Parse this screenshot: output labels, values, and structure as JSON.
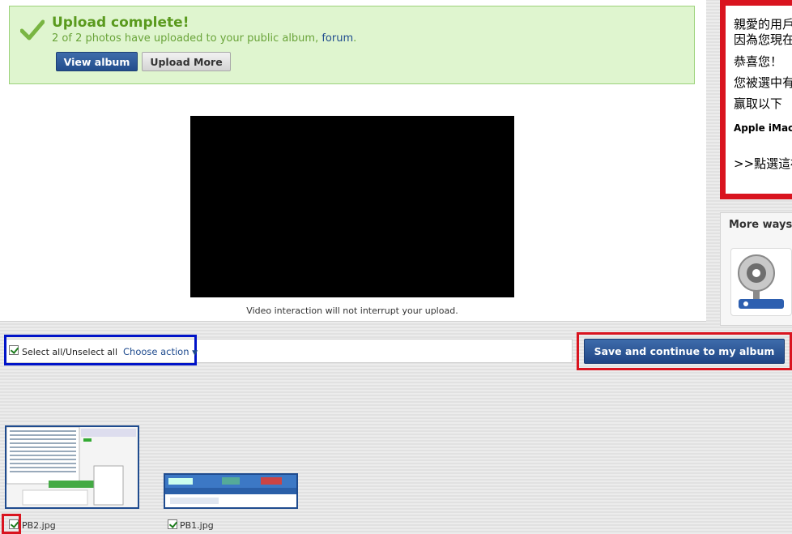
{
  "upload": {
    "title": "Upload complete!",
    "message": "2 of 2 photos have uploaded to your public album, ",
    "forum_link": "forum",
    "message_end": ".",
    "view_album_label": "View album",
    "upload_more_label": "Upload More"
  },
  "video": {
    "caption": "Video interaction will not interrupt your upload."
  },
  "ad": {
    "lines": [
      "親愛的用戶",
      "因為您現在",
      "恭喜您！",
      "您被選中有",
      "赢取以下",
      "Apple iMac -",
      ">>點選這裡"
    ]
  },
  "more_ways": {
    "title": "More ways"
  },
  "actions": {
    "select_all_label": "Select all/Unselect all",
    "choose_action_label": "Choose action",
    "save_label": "Save and continue to my album"
  },
  "photos": [
    {
      "filename": "PB2.jpg",
      "checked": true
    },
    {
      "filename": "PB1.jpg",
      "checked": true
    }
  ],
  "colors": {
    "accent_blue": "#234d8c",
    "success_green": "#5a9a1e",
    "highlight_red": "#d9141f",
    "highlight_blue": "#0013c8"
  }
}
